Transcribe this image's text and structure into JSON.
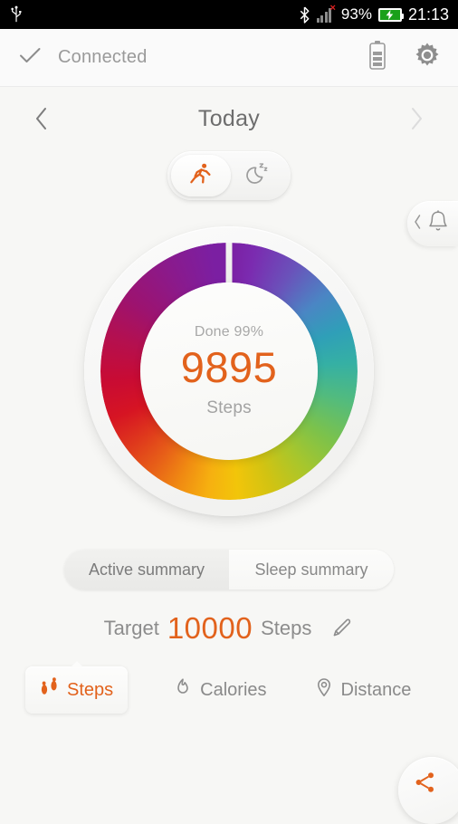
{
  "status_bar": {
    "usb_icon": "usb-icon",
    "bluetooth_icon": "bluetooth-icon",
    "signal_icon": "signal-bars-icon",
    "signal_error": "×",
    "battery_percent": "93%",
    "battery_icon": "battery-charging-icon",
    "time": "21:13"
  },
  "app_bar": {
    "status_icon": "check-icon",
    "connection_status": "Connected",
    "device_battery_icon": "device-battery-icon",
    "settings_icon": "gear-icon"
  },
  "date_nav": {
    "prev_icon": "chevron-left-icon",
    "title": "Today",
    "next_icon": "chevron-right-icon"
  },
  "mode_toggle": {
    "active_mode": "activity",
    "activity_icon": "running-person-icon",
    "sleep_icon": "moon-sleep-icon"
  },
  "alarm_drawer": {
    "expand_icon": "chevron-left-icon",
    "bell_icon": "bell-icon"
  },
  "progress_ring": {
    "done_label": "Done 99%",
    "value": "9895",
    "unit_label": "Steps",
    "accent_color": "#e2621c",
    "percent": 99
  },
  "summary_tabs": {
    "active": "Active summary",
    "sleep": "Sleep summary",
    "selected": "Active summary"
  },
  "target": {
    "prefix": "Target",
    "value": "10000",
    "unit": "Steps",
    "edit_icon": "pencil-icon"
  },
  "metrics": {
    "steps": {
      "label": "Steps",
      "icon": "footprints-icon"
    },
    "calories": {
      "label": "Calories",
      "icon": "flame-icon"
    },
    "distance": {
      "label": "Distance",
      "icon": "location-pin-icon"
    },
    "selected": "Steps"
  },
  "fab": {
    "icon": "share-icon",
    "color": "#e2621c"
  }
}
